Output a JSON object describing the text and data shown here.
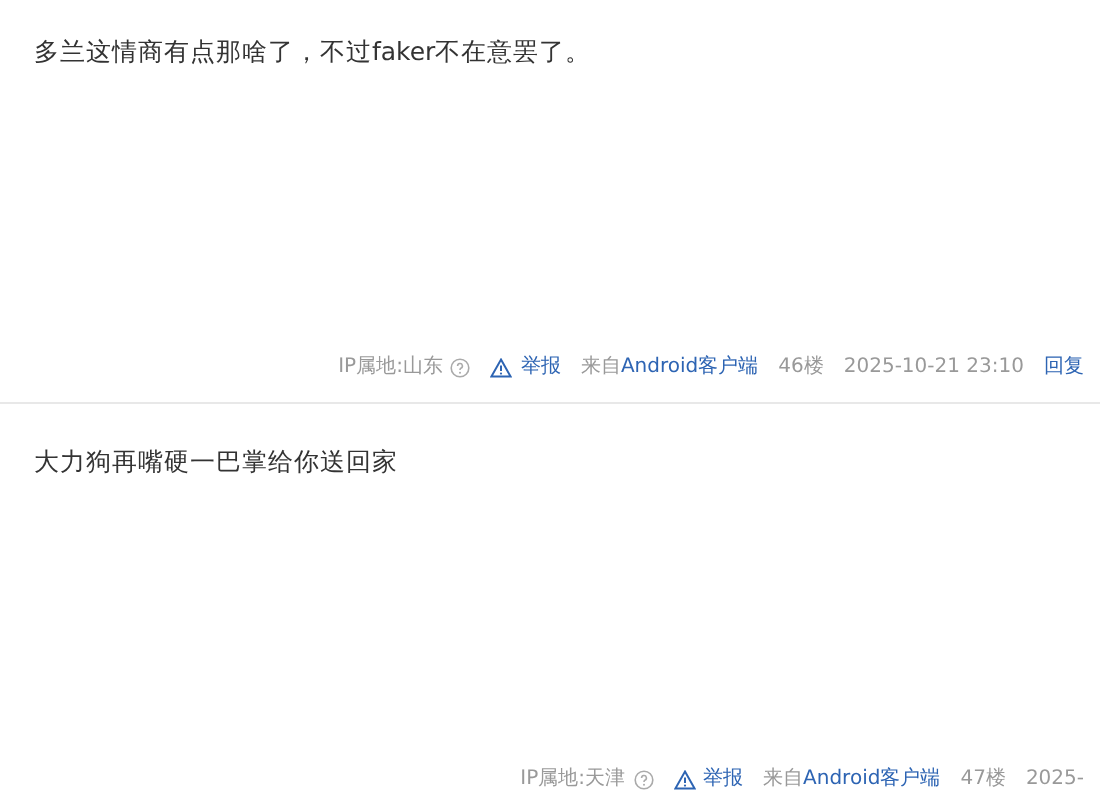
{
  "comments": [
    {
      "text": "多兰这情商有点那啥了，不过faker不在意罢了。",
      "ip_location": "IP属地:山东",
      "report": "举报",
      "source_prefix": "来自",
      "source_app": "Android客户端",
      "floor": "46楼",
      "time": "2025-10-21 23:10",
      "reply": "回复"
    },
    {
      "text": "大力狗再嘴硬一巴掌给你送回家",
      "ip_location": "IP属地:天津",
      "report": "举报",
      "source_prefix": "来自",
      "source_app": "Android客户端",
      "floor": "47楼",
      "time": "2025-"
    }
  ]
}
